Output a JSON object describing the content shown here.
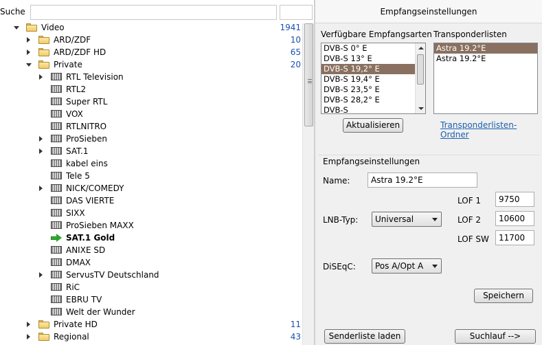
{
  "search": {
    "label": "Suche",
    "value": ""
  },
  "tree": [
    {
      "label": "Video",
      "count": "1941",
      "type": "folder",
      "level": 1,
      "expander": "down"
    },
    {
      "label": "ARD/ZDF",
      "count": "10",
      "type": "folder",
      "level": 2,
      "expander": "right"
    },
    {
      "label": "ARD/ZDF HD",
      "count": "65",
      "type": "folder",
      "level": 2,
      "expander": "right"
    },
    {
      "label": "Private",
      "count": "20",
      "type": "folder",
      "level": 2,
      "expander": "down"
    },
    {
      "label": "RTL Television",
      "count": "",
      "type": "tv",
      "level": 3,
      "expander": "right"
    },
    {
      "label": "RTL2",
      "count": "",
      "type": "tv",
      "level": 3,
      "expander": ""
    },
    {
      "label": "Super RTL",
      "count": "",
      "type": "tv",
      "level": 3,
      "expander": ""
    },
    {
      "label": "VOX",
      "count": "",
      "type": "tv",
      "level": 3,
      "expander": ""
    },
    {
      "label": "RTLNITRO",
      "count": "",
      "type": "tv",
      "level": 3,
      "expander": ""
    },
    {
      "label": "ProSieben",
      "count": "",
      "type": "tv",
      "level": 3,
      "expander": "right"
    },
    {
      "label": "SAT.1",
      "count": "",
      "type": "tv",
      "level": 3,
      "expander": "right"
    },
    {
      "label": "kabel eins",
      "count": "",
      "type": "tv",
      "level": 3,
      "expander": ""
    },
    {
      "label": "Tele 5",
      "count": "",
      "type": "tv",
      "level": 3,
      "expander": ""
    },
    {
      "label": "NICK/COMEDY",
      "count": "",
      "type": "tv",
      "level": 3,
      "expander": "right"
    },
    {
      "label": "DAS VIERTE",
      "count": "",
      "type": "tv",
      "level": 3,
      "expander": ""
    },
    {
      "label": "SIXX",
      "count": "",
      "type": "tv",
      "level": 3,
      "expander": ""
    },
    {
      "label": "ProSieben MAXX",
      "count": "",
      "type": "tv",
      "level": 3,
      "expander": ""
    },
    {
      "label": "SAT.1 Gold",
      "count": "",
      "type": "current",
      "level": 3,
      "expander": "",
      "bold": true
    },
    {
      "label": "ANIXE SD",
      "count": "",
      "type": "tv",
      "level": 3,
      "expander": ""
    },
    {
      "label": "DMAX",
      "count": "",
      "type": "tv",
      "level": 3,
      "expander": ""
    },
    {
      "label": "ServusTV Deutschland",
      "count": "",
      "type": "tv",
      "level": 3,
      "expander": "right"
    },
    {
      "label": "RiC",
      "count": "",
      "type": "tv",
      "level": 3,
      "expander": ""
    },
    {
      "label": "EBRU TV",
      "count": "",
      "type": "tv",
      "level": 3,
      "expander": ""
    },
    {
      "label": "Welt der Wunder",
      "count": "",
      "type": "tv",
      "level": 3,
      "expander": ""
    },
    {
      "label": "Private HD",
      "count": "11",
      "type": "folder",
      "level": 2,
      "expander": "right"
    },
    {
      "label": "Regional",
      "count": "43",
      "type": "folder",
      "level": 2,
      "expander": "right"
    }
  ],
  "right": {
    "header": "Empfangseinstellungen",
    "available_label": "Verfügbare Empfangsarten",
    "available_items": [
      "DVB-S 0° E",
      "DVB-S 13° E",
      "DVB-S 19,2° E",
      "DVB-S 19,4° E",
      "DVB-S 23,5° E",
      "DVB-S 28,2° E",
      "DVB-S"
    ],
    "available_selected": 2,
    "transponder_label": "Transponderlisten",
    "transponder_items": [
      "Astra 19.2°E",
      "Astra 19.2°E"
    ],
    "transponder_selected": 0,
    "refresh_button": "Aktualisieren",
    "folder_link": "Transponderlisten-Ordner",
    "group_title": "Empfangseinstellungen",
    "name_label": "Name:",
    "name_value": "Astra 19.2°E",
    "lnb_label": "LNB-Typ:",
    "lnb_value": "Universal",
    "lof1_label": "LOF 1",
    "lof1_value": "9750",
    "lof2_label": "LOF 2",
    "lof2_value": "10600",
    "lofsw_label": "LOF SW",
    "lofsw_value": "11700",
    "diseqc_label": "DiSEqC:",
    "diseqc_value": "Pos A/Opt A",
    "save_button": "Speichern",
    "load_button": "Senderliste laden",
    "scan_button": "Suchlauf -->"
  }
}
